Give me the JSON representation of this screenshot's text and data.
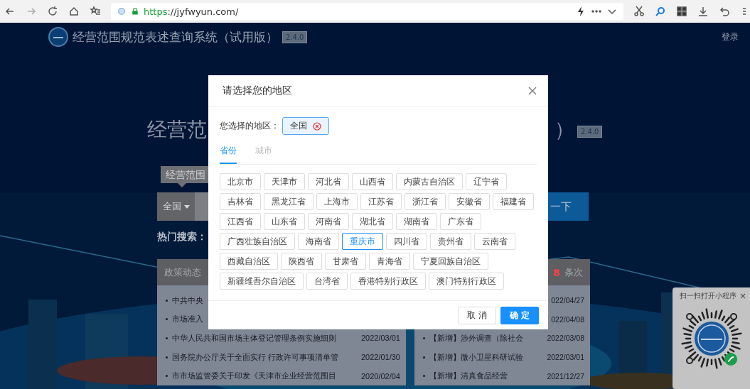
{
  "browser": {
    "url_scheme": "https",
    "url_rest": "://jyfwyun.com/"
  },
  "header": {
    "title": "经营范围规范表述查询系统（试用版）",
    "version": "2.4.0",
    "login": "登录"
  },
  "hero": {
    "title_start": "经营范",
    "title_end": "）",
    "version": "2.4.0"
  },
  "search": {
    "tab": "经营范围",
    "region": "全国",
    "button": "一下"
  },
  "hot_search": {
    "label": "热门搜索："
  },
  "news_left": {
    "title": "政策动态",
    "rows": [
      {
        "text": "中共中央"
      },
      {
        "text": "市场准入"
      },
      {
        "text": "中华人民共和国市场主体登记管理条例实施细则",
        "date": "2022/03/01"
      },
      {
        "text": "国务院办公厅关于全面实行 行政许可事项清单管",
        "date": "2022/01/30"
      },
      {
        "text": "市市场监管委关于印发《天津市企业经营范围目",
        "date": "2020/02/04"
      }
    ]
  },
  "news_right": {
    "count": "8",
    "unit": "条次",
    "rows": [
      {
        "date": "022/04/27"
      },
      {
        "date": "022/04/08"
      },
      {
        "tag": "【新增】",
        "text": "涉外调查（除社会",
        "date": "2022/03/08"
      },
      {
        "tag": "【新增】",
        "text": "微小卫星科研试验",
        "date": "2022/03/01"
      },
      {
        "tag": "【新增】",
        "text": "清真食品经营",
        "date": "2021/12/27"
      }
    ]
  },
  "dialog": {
    "title": "请选择您的地区",
    "selected_label": "您选择的地区：",
    "chip": "全国",
    "tabs": [
      {
        "label": "省份",
        "selected": true
      },
      {
        "label": "城市",
        "selected": false
      }
    ],
    "regions": [
      {
        "label": "北京市",
        "selected": false
      },
      {
        "label": "天津市",
        "selected": false
      },
      {
        "label": "河北省",
        "selected": false
      },
      {
        "label": "山西省",
        "selected": false
      },
      {
        "label": "内蒙古自治区",
        "selected": false
      },
      {
        "label": "辽宁省",
        "selected": false
      },
      {
        "label": "吉林省",
        "selected": false
      },
      {
        "label": "黑龙江省",
        "selected": false
      },
      {
        "label": "上海市",
        "selected": false
      },
      {
        "label": "江苏省",
        "selected": false
      },
      {
        "label": "浙江省",
        "selected": false
      },
      {
        "label": "安徽省",
        "selected": false
      },
      {
        "label": "福建省",
        "selected": false
      },
      {
        "label": "江西省",
        "selected": false
      },
      {
        "label": "山东省",
        "selected": false
      },
      {
        "label": "河南省",
        "selected": false
      },
      {
        "label": "湖北省",
        "selected": false
      },
      {
        "label": "湖南省",
        "selected": false
      },
      {
        "label": "广东省",
        "selected": false
      },
      {
        "label": "广西壮族自治区",
        "selected": false
      },
      {
        "label": "海南省",
        "selected": false
      },
      {
        "label": "重庆市",
        "selected": true
      },
      {
        "label": "四川省",
        "selected": false
      },
      {
        "label": "贵州省",
        "selected": false
      },
      {
        "label": "云南省",
        "selected": false
      },
      {
        "label": "西藏自治区",
        "selected": false
      },
      {
        "label": "陕西省",
        "selected": false
      },
      {
        "label": "甘肃省",
        "selected": false
      },
      {
        "label": "青海省",
        "selected": false
      },
      {
        "label": "宁夏回族自治区",
        "selected": false
      },
      {
        "label": "新疆维吾尔自治区",
        "selected": false
      },
      {
        "label": "台湾省",
        "selected": false
      },
      {
        "label": "香港特别行政区",
        "selected": false
      },
      {
        "label": "澳门特别行政区",
        "selected": false
      }
    ],
    "cancel": "取 消",
    "ok": "确 定"
  },
  "mini_program": {
    "title": "扫一扫打开小程序",
    "close": "×"
  }
}
